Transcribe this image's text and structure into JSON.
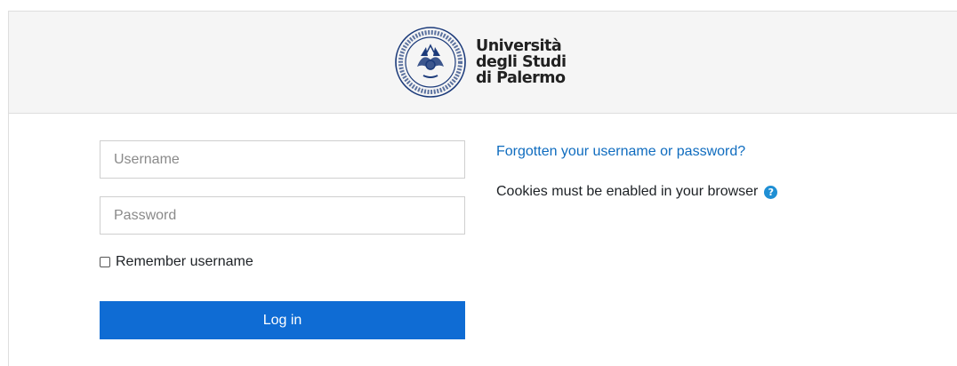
{
  "header": {
    "logo_line1": "Università",
    "logo_line2": "degli Studi",
    "logo_line3": "di Palermo",
    "seal_icon": "university-seal-icon",
    "seal_color": "#1b3a7a"
  },
  "login": {
    "username_placeholder": "Username",
    "password_placeholder": "Password",
    "remember_label": "Remember username",
    "remember_checked": false,
    "login_button_label": "Log in",
    "button_color": "#0f6cd4"
  },
  "side": {
    "forgot_link": "Forgotten your username or password?",
    "cookies_text": "Cookies must be enabled in your browser",
    "help_icon_glyph": "?",
    "link_color": "#0f6cbf"
  }
}
